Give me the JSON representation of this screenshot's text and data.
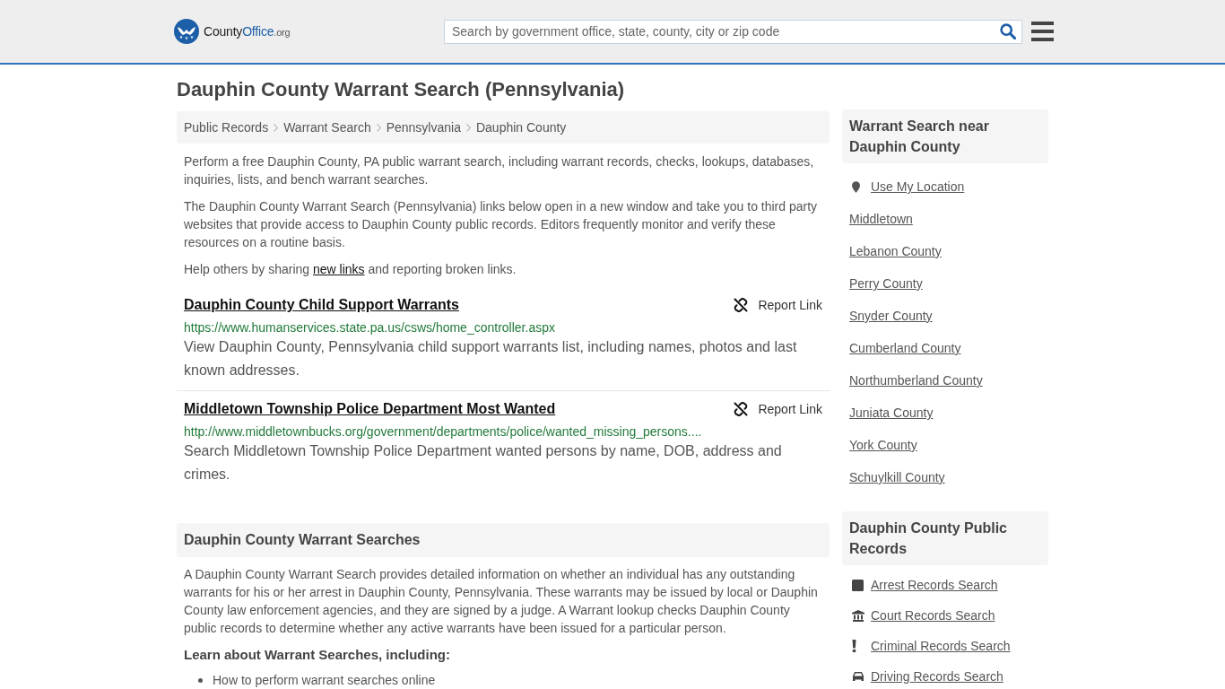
{
  "header": {
    "logo": {
      "text": "County",
      "accent": "Office",
      "domain": ".org"
    },
    "search": {
      "placeholder": "Search by government office, state, county, city or zip code"
    }
  },
  "page_title": "Dauphin County Warrant Search (Pennsylvania)",
  "breadcrumb": [
    "Public Records",
    "Warrant Search",
    "Pennsylvania",
    "Dauphin County"
  ],
  "intro": [
    "Perform a free Dauphin County, PA public warrant search, including warrant records, checks, lookups, databases, inquiries, lists, and bench warrant searches.",
    "The Dauphin County Warrant Search (Pennsylvania) links below open in a new window and take you to third party websites that provide access to Dauphin County public records. Editors frequently monitor and verify these resources on a routine basis."
  ],
  "share_note": {
    "before": "Help others by sharing ",
    "link": "new links",
    "after": " and reporting broken links."
  },
  "resources": [
    {
      "title": "Dauphin County Child Support Warrants",
      "report": "Report Link",
      "url": "https://www.humanservices.state.pa.us/csws/home_controller.aspx",
      "description": "View Dauphin County, Pennsylvania child support warrants list, including names, photos and last known addresses."
    },
    {
      "title": "Middletown Township Police Department Most Wanted",
      "report": "Report Link",
      "url": "http://www.middletownbucks.org/government/departments/police/wanted_missing_persons....",
      "description": "Search Middletown Township Police Department wanted persons by name, DOB, address and crimes."
    }
  ],
  "warrant_searches": {
    "heading": "Dauphin County Warrant Searches",
    "body": "A Dauphin County Warrant Search provides detailed information on whether an individual has any outstanding warrants for his or her arrest in Dauphin County, Pennsylvania. These warrants may be issued by local or Dauphin County law enforcement agencies, and they are signed by a judge. A Warrant lookup checks Dauphin County public records to determine whether any active warrants have been issued for a particular person.",
    "subheading": "Learn about Warrant Searches, including:",
    "bullets": [
      "How to perform warrant searches online"
    ]
  },
  "sidebar": [
    {
      "heading": "Warrant Search near Dauphin County",
      "items": [
        {
          "kind": "location",
          "label": "Use My Location"
        },
        {
          "kind": "place",
          "label": "Middletown"
        },
        {
          "kind": "place",
          "label": "Lebanon County"
        },
        {
          "kind": "place",
          "label": "Perry County"
        },
        {
          "kind": "place",
          "label": "Snyder County"
        },
        {
          "kind": "place",
          "label": "Cumberland County"
        },
        {
          "kind": "place",
          "label": "Northumberland County"
        },
        {
          "kind": "place",
          "label": "Juniata County"
        },
        {
          "kind": "place",
          "label": "York County"
        },
        {
          "kind": "place",
          "label": "Schuylkill County"
        }
      ]
    },
    {
      "heading": "Dauphin County Public Records",
      "items": [
        {
          "kind": "arrest",
          "label": "Arrest Records Search"
        },
        {
          "kind": "court",
          "label": "Court Records Search"
        },
        {
          "kind": "criminal",
          "label": "Criminal Records Search"
        },
        {
          "kind": "driving",
          "label": "Driving Records Search"
        }
      ]
    }
  ]
}
